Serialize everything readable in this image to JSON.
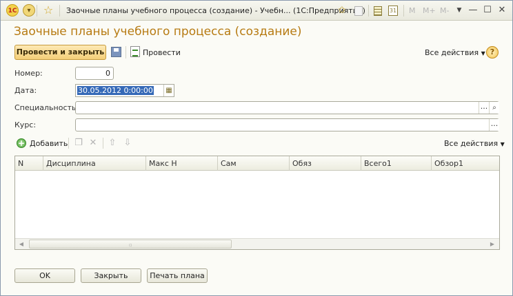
{
  "window": {
    "title": "Заочные планы учебного процесса (создание) - Учебн...  (1С:Предприятие)",
    "logo_text": "1С",
    "toolbar_m": [
      "M",
      "M+",
      "M-"
    ],
    "calendar_text": "31"
  },
  "form": {
    "title": "Заочные планы учебного процесса (создание)"
  },
  "command_bar": {
    "post_close": "Провести и закрыть",
    "post": "Провести",
    "all_actions": "Все действия",
    "help": "?"
  },
  "fields": {
    "number_label": "Номер:",
    "number_value": "0",
    "date_label": "Дата:",
    "date_value": "30.05.2012  0:00:00",
    "specialty_label": "Специальность:",
    "specialty_value": "",
    "course_label": "Курс:",
    "course_value": "",
    "select_button": "...",
    "open_button": "🔍"
  },
  "table": {
    "add_label": "Добавить",
    "all_actions": "Все действия",
    "columns": [
      "N",
      "Дисциплина",
      "Макс Н",
      "Сам",
      "Обяз",
      "Всего1",
      "Обзор1"
    ],
    "rows": []
  },
  "footer": {
    "ok": "OK",
    "close": "Закрыть",
    "print": "Печать плана"
  }
}
